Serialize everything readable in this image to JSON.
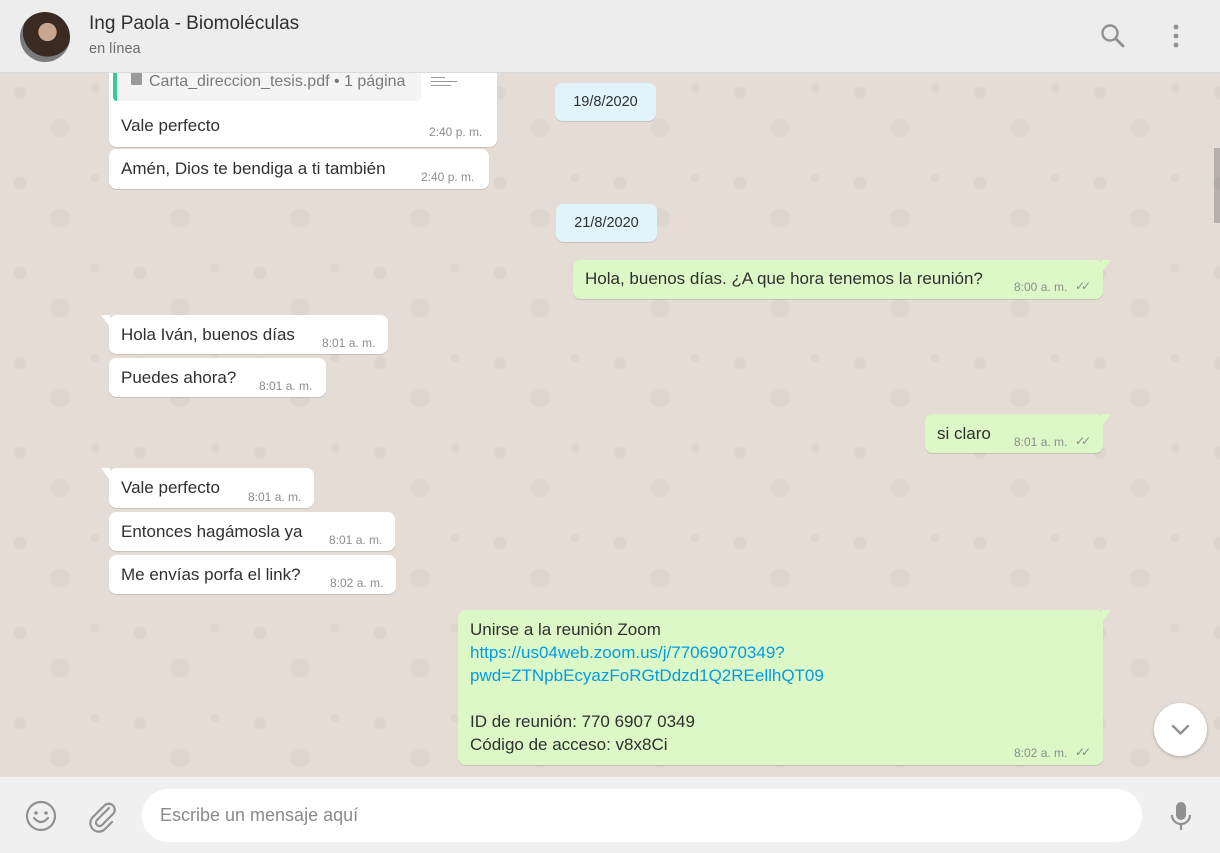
{
  "header": {
    "contact_name": "Ing Paola - Biomoléculas",
    "status": "en línea",
    "icons": [
      "search-icon",
      "menu-icon"
    ]
  },
  "document": {
    "file_label": "Carta_direccion_tesis.pdf • 1 página"
  },
  "messages": [
    {
      "dir": "in",
      "text": "Vale perfecto",
      "time": "2:40 p. m."
    },
    {
      "dir": "in",
      "text": "Amén, Dios te bendiga a ti también",
      "time": "2:40 p. m."
    },
    {
      "dir": "out",
      "text": "Hola, buenos días. ¿A que hora tenemos la reunión?",
      "time": "8:00 a. m.",
      "read": true
    },
    {
      "dir": "in",
      "text": "Hola Iván, buenos días",
      "time": "8:01 a. m."
    },
    {
      "dir": "in",
      "text": "Puedes ahora?",
      "time": "8:01 a. m."
    },
    {
      "dir": "out",
      "text": "si claro",
      "time": "8:01 a. m.",
      "read": true
    },
    {
      "dir": "in",
      "text": "Vale perfecto",
      "time": "8:01 a. m."
    },
    {
      "dir": "in",
      "text": "Entonces hagámosla ya",
      "time": "8:01 a. m."
    },
    {
      "dir": "in",
      "text": "Me envías porfa el link?",
      "time": "8:02 a. m."
    }
  ],
  "date_chips": [
    "19/8/2020",
    "21/8/2020"
  ],
  "zoom_message": {
    "line1": "Unirse a la reunión Zoom",
    "link_line1": "https://us04web.zoom.us/j/77069070349?",
    "link_line2": "pwd=ZTNpbEcyazFoRGtDdzd1Q2REellhQT09",
    "meeting_id": "ID de reunión: 770 6907 0349",
    "passcode": "Código de acceso: v8x8Ci",
    "time": "8:02 a. m."
  },
  "composer": {
    "placeholder": "Escribe un mensaje aquí",
    "icons": [
      "emoji-icon",
      "attach-icon",
      "microphone-icon"
    ]
  },
  "colors": {
    "chat_bg": "#e5ddd5",
    "incoming": "#ffffff",
    "outgoing": "#dcf8c6",
    "date_chip": "#e1f3fb",
    "link": "#039be5"
  }
}
